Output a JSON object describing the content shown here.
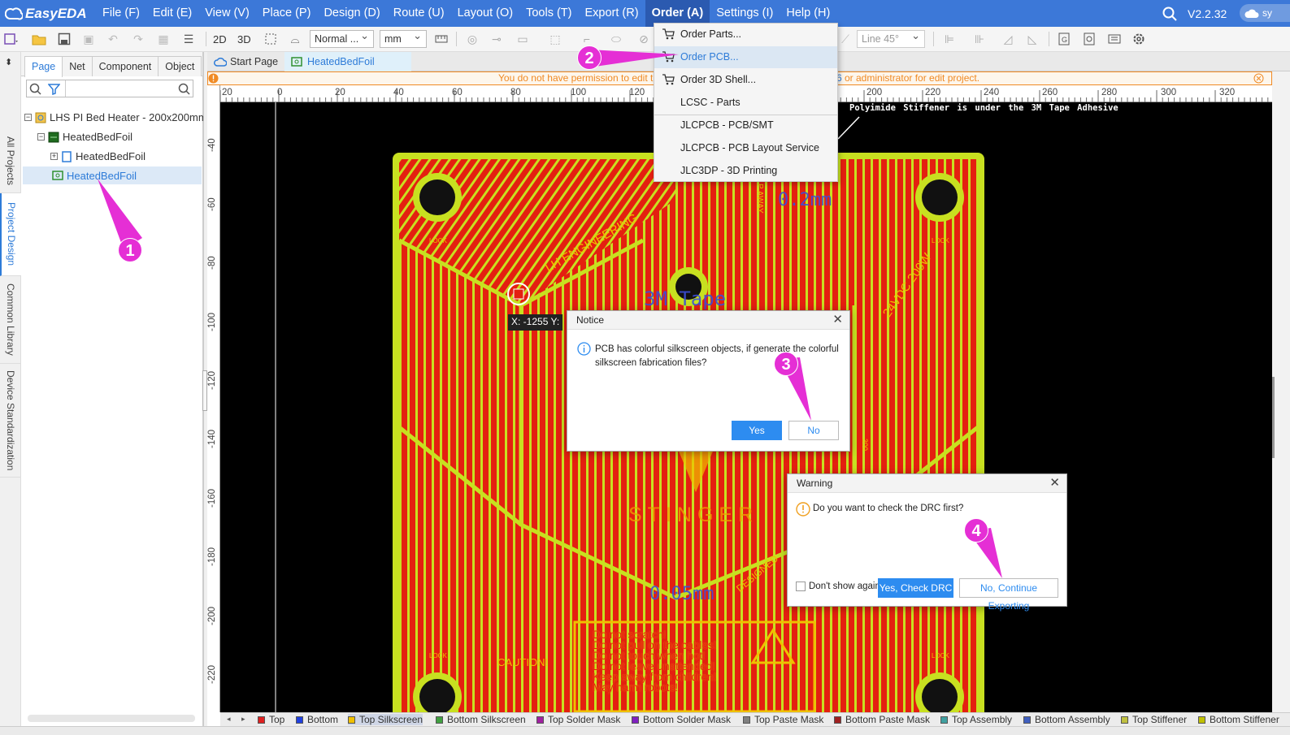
{
  "app": {
    "logo": "EasyEDA",
    "version": "V2.2.32",
    "account_badge": "sy"
  },
  "menubar": {
    "items": [
      "File (F)",
      "Edit (E)",
      "View (V)",
      "Place (P)",
      "Design (D)",
      "Route (U)",
      "Layout (O)",
      "Tools (T)",
      "Export (R)",
      "Order (A)",
      "Settings (I)",
      "Help (H)"
    ],
    "active": "Order (A)"
  },
  "toolbar": {
    "view_2d": "2D",
    "view_3d": "3D",
    "mode_select": "Normal ...",
    "unit_select": "mm",
    "line_select": "Line 45°"
  },
  "left_tabs": [
    "All Projects",
    "Project Design",
    "Common Library",
    "Device Standardization"
  ],
  "panel": {
    "tabs": [
      "Page",
      "Net",
      "Component",
      "Object"
    ],
    "active_tab": "Page",
    "tree": {
      "project": "LHS PI Bed Heater - 200x200mm",
      "board": "HeatedBedFoil",
      "schematic": "HeatedBedFoil",
      "pcb": "HeatedBedFoil"
    }
  },
  "doc_tabs": {
    "start": "Start Page",
    "pcb": "HeatedBedFoil"
  },
  "permission_bar": {
    "left": "You do not have permission to edit th",
    "right_frag": "6",
    "right": "or administrator for edit project."
  },
  "rulers": {
    "h": [
      "20",
      "0",
      "20",
      "40",
      "60",
      "80",
      "100",
      "120",
      "200",
      "220",
      "240",
      "260",
      "280",
      "300",
      "320"
    ],
    "v": [
      "-40",
      "-60",
      "-80",
      "-100",
      "-120",
      "-140",
      "-160",
      "-180",
      "-200",
      "-220"
    ]
  },
  "canvas": {
    "note": "Polyimide Stiffener is under the 3M Tape Adhesive",
    "dim_top": "0.2mm",
    "tape_label": "3M Tape",
    "dim_bottom": "0.05mm",
    "brand": "STINGER",
    "engineering": "LH ENGINEERING",
    "voltage": "24VDC 200W",
    "caution": "CAUTION!",
    "warnings": [
      "Do not scratch!",
      "Do not pull on the cables!",
      "Do not touch when hot!",
      "Do not leave unattended!",
      "Keep away from children!",
      "May harm robots!"
    ],
    "lock": "LOCK",
    "away": "P AWAY",
    "designer": "DESIGNED",
    "size": "300",
    "coord_readout": "X: -1255 Y:"
  },
  "order_menu": {
    "items": [
      "Order Parts...",
      "Order PCB...",
      "Order 3D Shell...",
      "LCSC - Parts",
      "JLCPCB - PCB/SMT",
      "JLCPCB - PCB Layout Service",
      "JLC3DP - 3D Printing"
    ],
    "highlighted": "Order PCB..."
  },
  "notice_dialog": {
    "title": "Notice",
    "message": "PCB has colorful silkscreen objects, if generate the colorful silkscreen fabrication files?",
    "yes": "Yes",
    "no": "No"
  },
  "warning_dialog": {
    "title": "Warning",
    "message": "Do you want to check the DRC first?",
    "checkbox": "Don't show again",
    "yes": "Yes, Check DRC",
    "no": "No, Continue Exporting"
  },
  "callouts": [
    "1",
    "2",
    "3",
    "4"
  ],
  "layers": [
    {
      "name": "Top",
      "color": "#e02020"
    },
    {
      "name": "Bottom",
      "color": "#2040e0"
    },
    {
      "name": "Top Silkscreen",
      "color": "#f0c000"
    },
    {
      "name": "Bottom Silkscreen",
      "color": "#40a040"
    },
    {
      "name": "Top Solder Mask",
      "color": "#a020a0"
    },
    {
      "name": "Bottom Solder Mask",
      "color": "#8020c0"
    },
    {
      "name": "Top Paste Mask",
      "color": "#808080"
    },
    {
      "name": "Bottom Paste Mask",
      "color": "#a02020"
    },
    {
      "name": "Top Assembly",
      "color": "#40a0a0"
    },
    {
      "name": "Bottom Assembly",
      "color": "#4060c0"
    },
    {
      "name": "Top Stiffener",
      "color": "#c0c040"
    },
    {
      "name": "Bottom Stiffener",
      "color": "#c0c000"
    }
  ],
  "colors": {
    "menubar": "#3c78d8",
    "accent": "#2d8cf0",
    "callout": "#e52fd5",
    "board_fill": "#e42010",
    "silkscreen": "#c8e020"
  }
}
